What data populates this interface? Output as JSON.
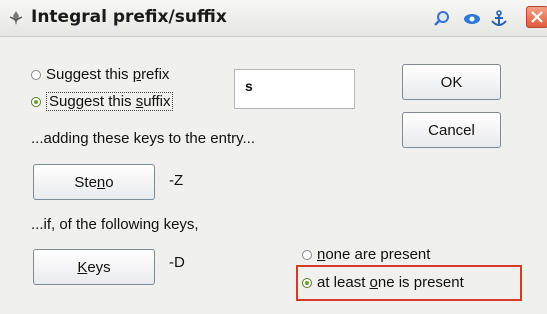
{
  "window": {
    "title": "Integral prefix/suffix",
    "titlebar_icons": [
      "search-icon",
      "eye-icon",
      "anchor-icon",
      "close-icon"
    ]
  },
  "options": {
    "prefix": {
      "pre": "Suggest this ",
      "accel": "p",
      "post": "refix",
      "selected": false
    },
    "suffix": {
      "pre": "Suggest this ",
      "accel": "s",
      "post": "uffix",
      "selected": true
    }
  },
  "text_field": {
    "value": "s"
  },
  "buttons": {
    "ok": "OK",
    "cancel": "Cancel",
    "steno": {
      "pre": "Ste",
      "accel": "n",
      "post": "o"
    },
    "keys": {
      "pre": "",
      "accel": "K",
      "post": "eys"
    }
  },
  "labels": {
    "adding": "...adding these keys to the entry...",
    "steno_value": "-Z",
    "if_keys": "...if, of the following keys,",
    "keys_value": "-D"
  },
  "presence": {
    "none": {
      "pre": "",
      "accel": "n",
      "post": "one are present",
      "selected": false
    },
    "at_least": {
      "pre": "at least ",
      "accel": "o",
      "post": "ne is present",
      "selected": true
    }
  },
  "colors": {
    "highlight": "#d83a2a",
    "radio_selected": "#6aa32a",
    "close_button": "#e05b3a"
  }
}
